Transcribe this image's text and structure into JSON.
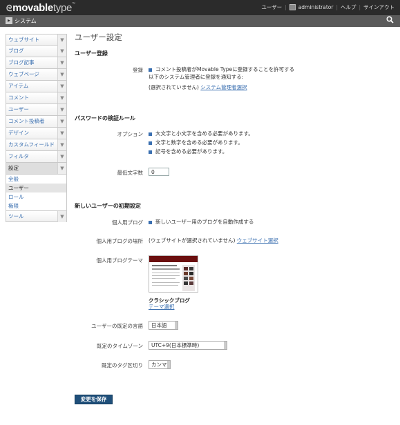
{
  "brand": {
    "logo_bold": "movable",
    "logo_light": "type",
    "logo_mark": "™"
  },
  "topbar": {
    "user_label": "ユーザー",
    "username": "administrator",
    "help": "ヘルプ",
    "signout": "サインアウト"
  },
  "sysbar": {
    "label": "システム"
  },
  "sidebar": {
    "items": [
      {
        "label": "ウェブサイト"
      },
      {
        "label": "ブログ"
      },
      {
        "label": "ブログ記事"
      },
      {
        "label": "ウェブページ"
      },
      {
        "label": "アイテム"
      },
      {
        "label": "コメント"
      },
      {
        "label": "ユーザー"
      },
      {
        "label": "コメント投稿者"
      },
      {
        "label": "デザイン"
      },
      {
        "label": "カスタムフィールド"
      },
      {
        "label": "フィルタ"
      },
      {
        "label": "設定"
      }
    ],
    "sub_items": [
      {
        "label": "全般"
      },
      {
        "label": "ユーザー"
      },
      {
        "label": "ロール"
      },
      {
        "label": "権限"
      }
    ],
    "last_item": {
      "label": "ツール"
    },
    "arrow": "▼"
  },
  "page": {
    "title": "ユーザー設定"
  },
  "registration": {
    "section_title": "ユーザー登録",
    "label": "登録",
    "option_line1": "コメント投稿者がMovable Typeに登録することを許可する",
    "option_line2": "以下のシステム管理者に登録を通知する:",
    "not_selected": "(選択されていません)",
    "select_link": "システム管理者選択"
  },
  "password": {
    "section_title": "パスワードの検証ルール",
    "options_label": "オプション",
    "opt1": "大文字と小文字を含める必要があります。",
    "opt2": "文字と数字を含める必要があります。",
    "opt3": "記号を含める必要があります。",
    "minlen_label": "最低文字数",
    "minlen_value": "0"
  },
  "newuser": {
    "section_title": "新しいユーザーの初期設定",
    "blog_label": "個人用ブログ",
    "blog_option": "新しいユーザー用のブログを自動作成する",
    "location_label": "個人用ブログの場所",
    "location_not_selected": "(ウェブサイトが選択されていません)",
    "location_link": "ウェブサイト選択",
    "theme_label": "個人用ブログテーマ",
    "theme_name": "クラシックブログ",
    "theme_link": "テーマ選択",
    "language_label": "ユーザーの既定の言語",
    "language_value": "日本語",
    "timezone_label": "既定のタイムゾーン",
    "timezone_value": "UTC+9(日本標準時)",
    "tag_label": "既定のタグ区切り",
    "tag_value": "カンマ"
  },
  "actions": {
    "save_label": "変更を保存"
  }
}
